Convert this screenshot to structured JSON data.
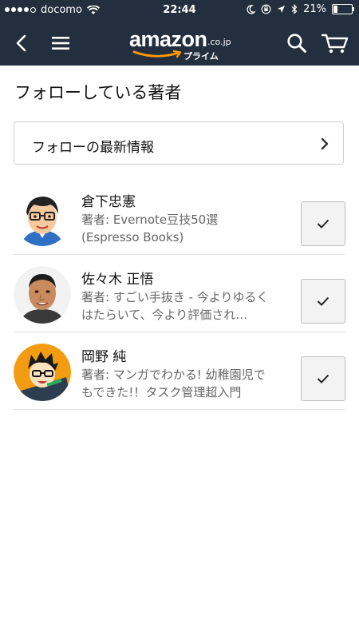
{
  "status_bar": {
    "carrier": "docomo",
    "time": "22:44",
    "battery": "21%",
    "battery_level": 0.21,
    "icons": [
      "signal-dots",
      "wifi-icon",
      "moon-icon",
      "rotation-lock-icon",
      "location-icon",
      "bluetooth-icon",
      "battery-icon"
    ]
  },
  "nav": {
    "logo_word": "amazon",
    "logo_tld": ".co.jp",
    "logo_prime": "プライム",
    "icons": [
      "back-icon",
      "menu-icon",
      "search-icon",
      "cart-icon"
    ],
    "bar_color": "#232f3e",
    "accent_color": "#ff9900"
  },
  "page": {
    "title": "フォローしている著者",
    "latest_label": "フォローの最新情報"
  },
  "authors": [
    {
      "name": "倉下忠憲",
      "books": "著者: Evernote豆技50選 (Espresso Books)",
      "following": true
    },
    {
      "name": "佐々木 正悟",
      "books": "著者: すごい手抜き - 今よりゆるくはたらいて、今より評価され…",
      "following": true
    },
    {
      "name": "岡野 純",
      "books": "著者: マンガでわかる! 幼稚園児でもできた!！タスク管理超入門",
      "following": true
    }
  ]
}
